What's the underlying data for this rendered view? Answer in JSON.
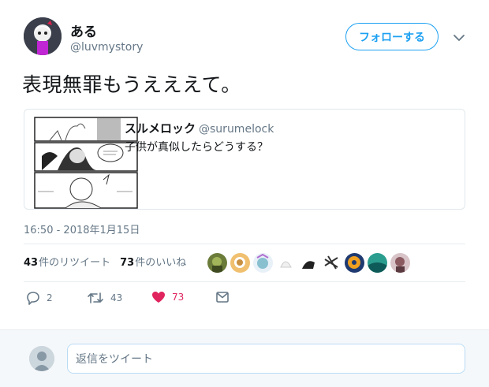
{
  "author": {
    "name": "ある",
    "handle": "@luvmystory"
  },
  "follow_button": {
    "label": "フォローする"
  },
  "tweet": {
    "text": "表現無罪もうえええて。"
  },
  "quoted_tweet": {
    "name": "スルメロック",
    "handle": "@surumelock",
    "text": "子供が真似したらどうする？"
  },
  "timestamp": "16:50 - 2018年1月15日",
  "stats": {
    "retweets_count": "43",
    "retweets_label": "件のリツイート",
    "likes_count": "73",
    "likes_label": "件のいいね"
  },
  "likers_count": 9,
  "actions": {
    "reply_count": "2",
    "retweet_count": "43",
    "like_count": "73"
  },
  "reply": {
    "placeholder": "返信をツイート"
  },
  "colors": {
    "accent": "#1da1f2",
    "like": "#e0245e",
    "muted": "#657786"
  }
}
